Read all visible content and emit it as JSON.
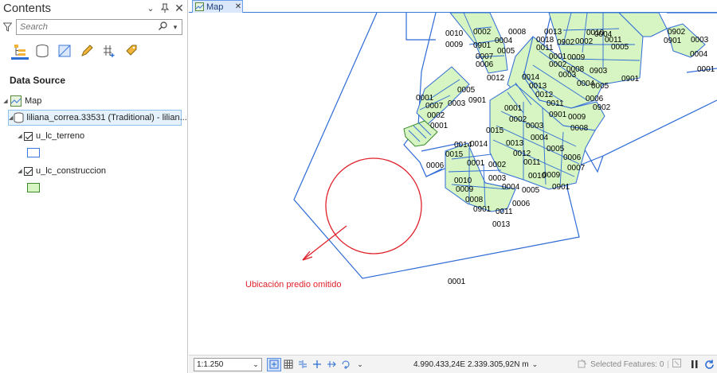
{
  "contents": {
    "title": "Contents",
    "search_placeholder": "Search",
    "section_title": "Data Source",
    "tree": {
      "map_label": "Map",
      "source_label": "liliana_correa.33531 (Traditional) - lilian...",
      "layers": [
        {
          "label": "u_lc_terreno",
          "swatch_fill": "#ffffff",
          "swatch_border": "#3c78e0"
        },
        {
          "label": "u_lc_construccion",
          "swatch_fill": "#d6f5c2",
          "swatch_border": "#3a8a2a"
        }
      ]
    }
  },
  "map": {
    "tab_label": "Map",
    "annotation": "Ubicación predio omitido",
    "parcel_labels": [
      "0010",
      "0002",
      "0008",
      "0009",
      "0901",
      "0004",
      "0007",
      "0005",
      "0006",
      "0012",
      "0011",
      "0013",
      "0902",
      "0018",
      "0011",
      "0002",
      "0010",
      "0004",
      "0005",
      "0001",
      "0009",
      "0002",
      "0008",
      "0903",
      "0003",
      "0014",
      "0004",
      "0901",
      "0013",
      "0005",
      "0012",
      "0006",
      "0011",
      "0902",
      "0901",
      "0009",
      "0008",
      "0902",
      "0901",
      "0003",
      "0004",
      "0001",
      "0001",
      "0007",
      "0005",
      "0003",
      "0901",
      "0002",
      "0001",
      "0001",
      "0002",
      "0015",
      "0003",
      "0014",
      "0013",
      "0004",
      "0012",
      "0005",
      "0011",
      "0006",
      "0014",
      "0010",
      "0007",
      "0015",
      "0009",
      "0901",
      "0006",
      "0001",
      "0002",
      "0010",
      "0003",
      "0009",
      "0004",
      "0008",
      "0005",
      "0006",
      "0901",
      "0011",
      "0013",
      "0001"
    ],
    "colors": {
      "parcel_line": "#2e6bd6",
      "building_fill": "#d6f5c2",
      "building_line": "#3a8a2a",
      "circle": "#e0202a"
    }
  },
  "status": {
    "scale": "1:1.250",
    "coordinates": "4.990.433,24E 2.339.305,92N m",
    "selected_features": "Selected Features: 0"
  }
}
